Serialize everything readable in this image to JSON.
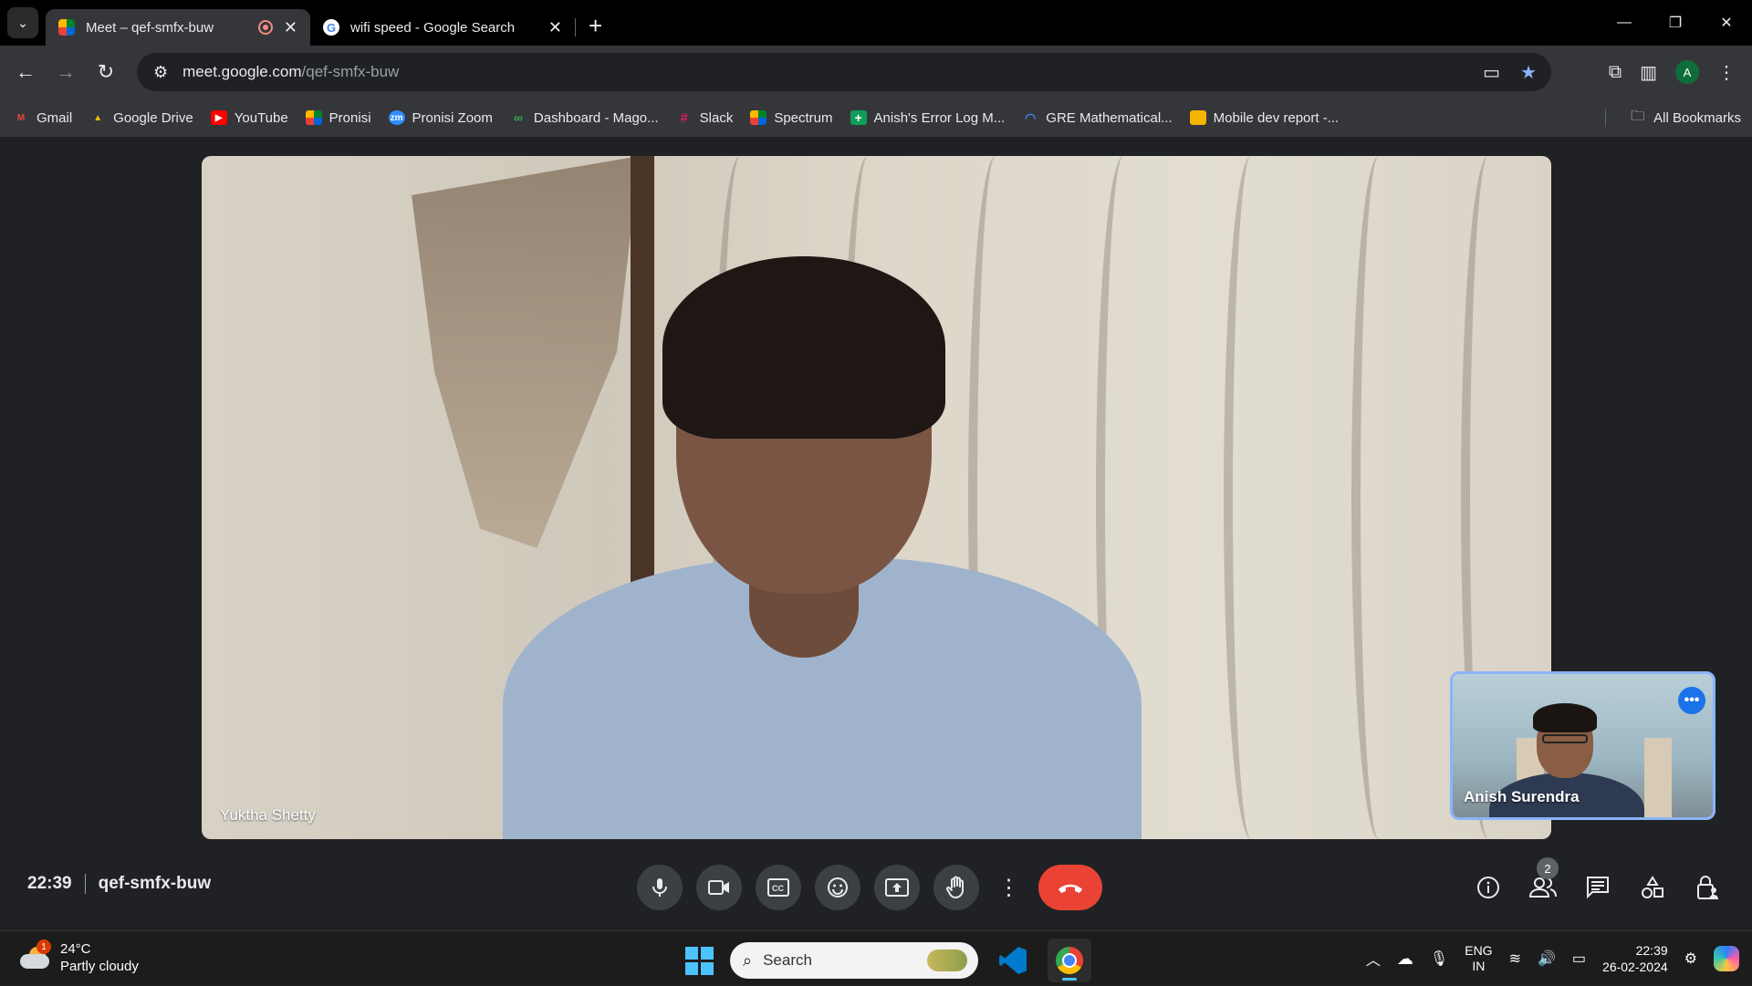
{
  "browser": {
    "tabs": [
      {
        "title": "Meet – qef-smfx-buw",
        "active": true
      },
      {
        "title": "wifi speed - Google Search",
        "active": false
      }
    ],
    "url_host": "meet.google.com",
    "url_path": "/qef-smfx-buw",
    "profile_initial": "A"
  },
  "bookmarks": {
    "items": [
      {
        "label": "Gmail",
        "color": "#ea4335",
        "glyph": "M"
      },
      {
        "label": "Google Drive",
        "color": "#fbbc05",
        "glyph": "▲"
      },
      {
        "label": "YouTube",
        "color": "#ff0000",
        "glyph": "▶"
      },
      {
        "label": "Pronisi",
        "color": "#34a853",
        "glyph": "■"
      },
      {
        "label": "Pronisi Zoom",
        "color": "#2d8cff",
        "glyph": "zm"
      },
      {
        "label": "Dashboard - Mago...",
        "color": "#34a853",
        "glyph": "∞"
      },
      {
        "label": "Slack",
        "color": "#611f69",
        "glyph": "#"
      },
      {
        "label": "Spectrum",
        "color": "#34a853",
        "glyph": "■"
      },
      {
        "label": "Anish's Error Log M...",
        "color": "#0f9d58",
        "glyph": "+"
      },
      {
        "label": "GRE Mathematical...",
        "color": "#4285f4",
        "glyph": "◠"
      },
      {
        "label": "Mobile dev report -...",
        "color": "#f4b400",
        "glyph": "▭"
      }
    ],
    "all_label": "All Bookmarks"
  },
  "meet": {
    "main_participant": "Yuktha Shetty",
    "self_participant": "Anish Surendra",
    "time": "22:39",
    "meeting_code": "qef-smfx-buw",
    "participant_count": "2",
    "accent_color": "#8ab4f8",
    "end_call_color": "#ea4335",
    "controls": [
      "microphone",
      "camera",
      "captions",
      "reactions",
      "present",
      "raise-hand",
      "more-options",
      "leave-call"
    ],
    "right_controls": [
      "meeting-details",
      "people",
      "chat",
      "activities",
      "host-controls"
    ]
  },
  "taskbar": {
    "weather_temp": "24°C",
    "weather_desc": "Partly cloudy",
    "weather_badge": "1",
    "search_placeholder": "Search",
    "lang_line1": "ENG",
    "lang_line2": "IN",
    "clock_time": "22:39",
    "clock_date": "26-02-2024"
  }
}
